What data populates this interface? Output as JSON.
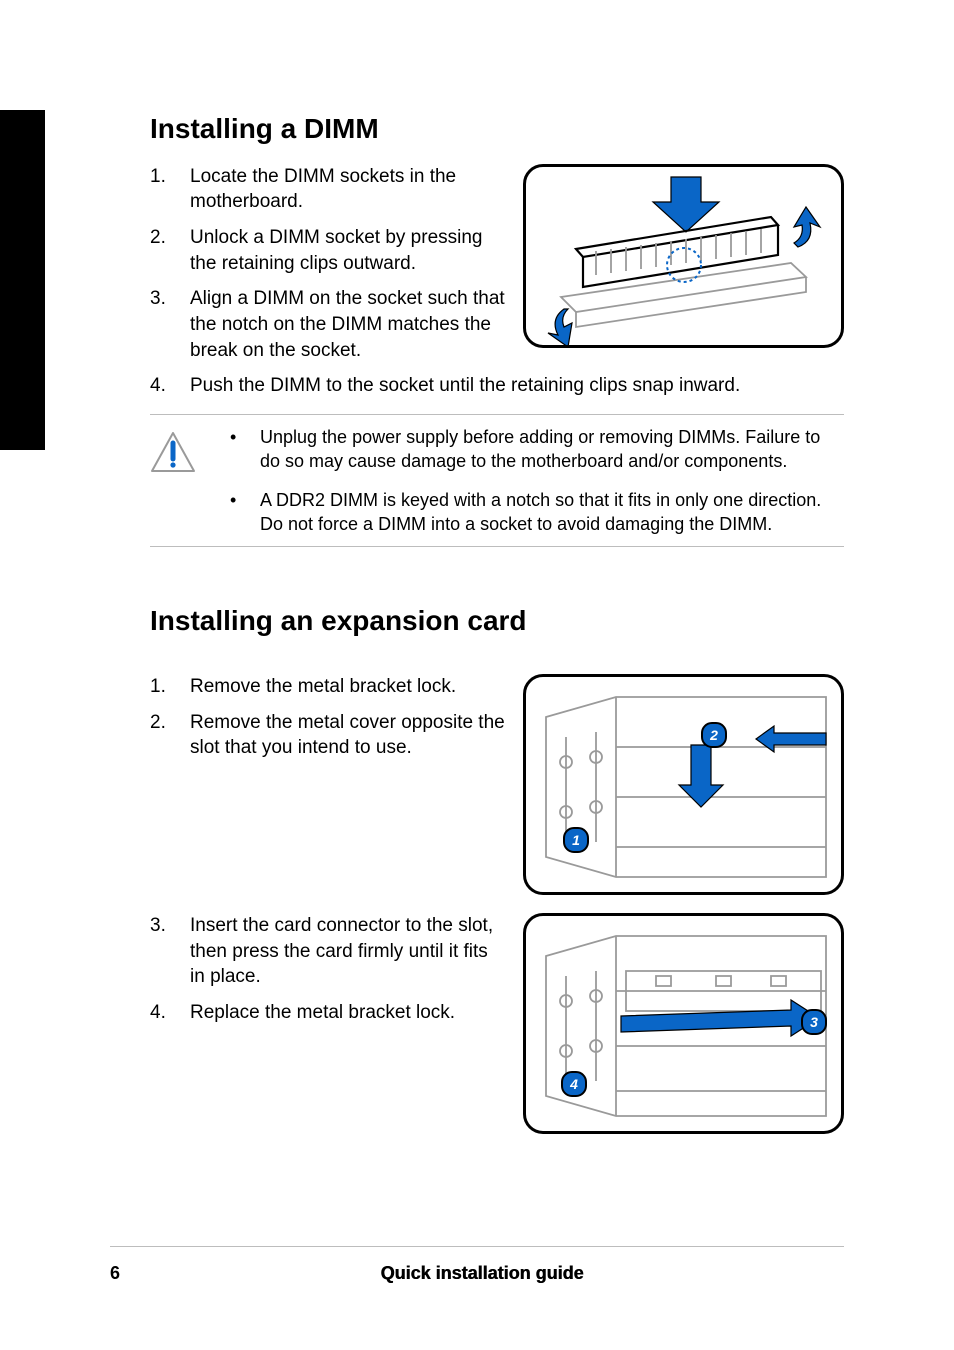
{
  "section1": {
    "heading": "Installing a DIMM",
    "steps": [
      "Locate the DIMM sockets in the motherboard.",
      "Unlock a DIMM socket by pressing the retaining clips outward.",
      "Align a DIMM on the socket such that the notch on the DIMM matches the break on the socket.",
      "Push the DIMM to the socket until the retaining clips snap inward."
    ],
    "notes": [
      "Unplug the power supply before adding or removing DIMMs. Failure to do so may cause damage to the motherboard and/or components.",
      "A DDR2 DIMM is keyed with a notch so that it fits in only one direction. Do not force a DIMM into a socket to avoid damaging the DIMM."
    ]
  },
  "section2": {
    "heading": "Installing an expansion card",
    "steps_a": [
      "Remove the metal bracket lock.",
      "Remove the metal cover opposite the slot that you intend to use."
    ],
    "steps_b": [
      "Insert the card connector to the slot, then press the card firmly until it fits in place.",
      "Replace the metal bracket lock."
    ]
  },
  "footer": {
    "page": "6",
    "title": "Quick installation guide"
  },
  "callouts": {
    "c1": "1",
    "c2": "2",
    "c3": "3",
    "c4": "4"
  }
}
